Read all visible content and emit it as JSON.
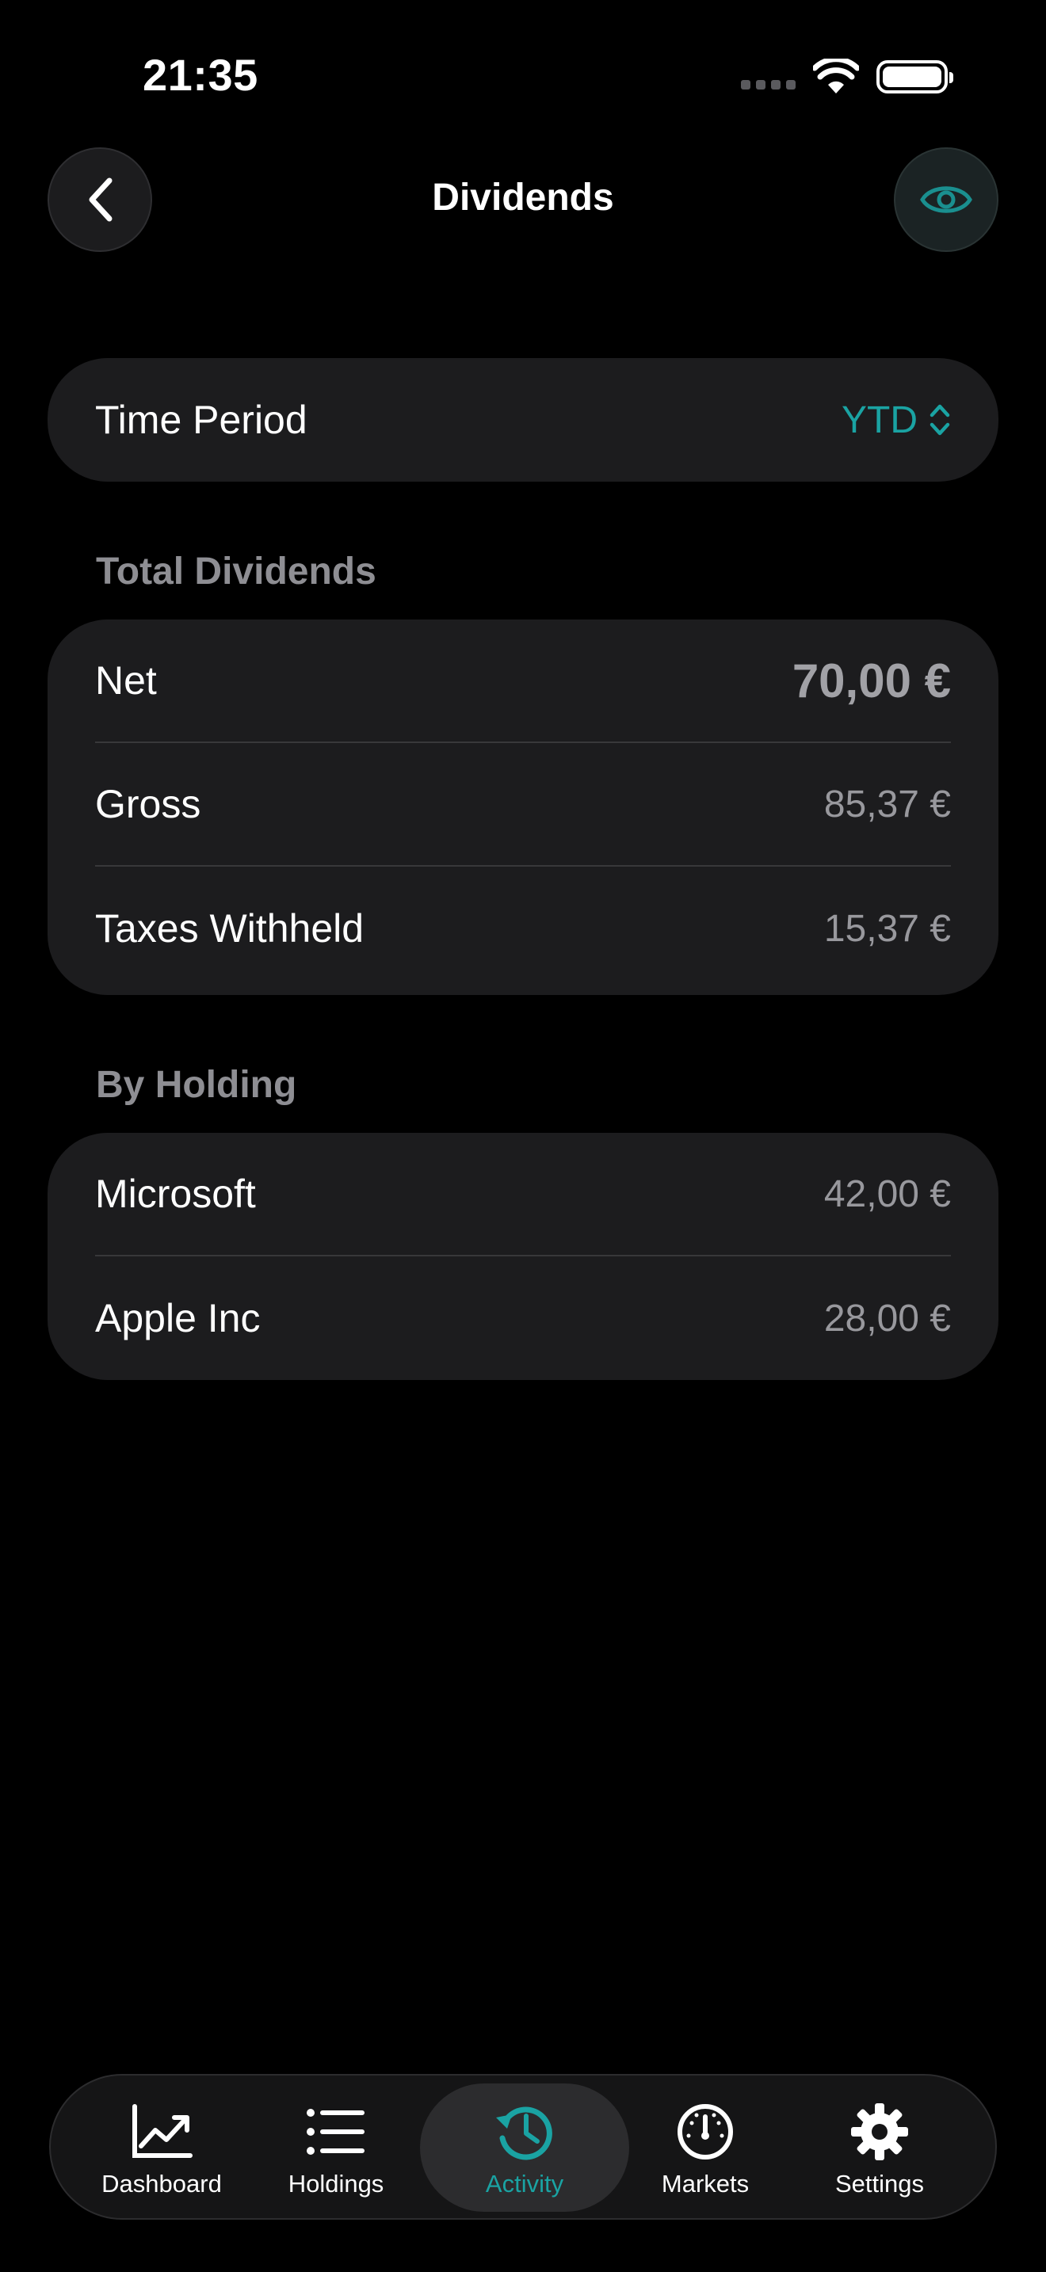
{
  "status": {
    "time": "21:35"
  },
  "nav": {
    "title": "Dividends",
    "back_icon": "chevron-left-icon",
    "visibility_icon": "eye-icon"
  },
  "time_period": {
    "label": "Time Period",
    "value": "YTD"
  },
  "total_dividends": {
    "section_title": "Total Dividends",
    "rows": [
      {
        "label": "Net",
        "value": "70,00 €"
      },
      {
        "label": "Gross",
        "value": "85,37 €"
      },
      {
        "label": "Taxes Withheld",
        "value": "15,37 €"
      }
    ]
  },
  "by_holding": {
    "section_title": "By Holding",
    "rows": [
      {
        "label": "Microsoft",
        "value": "42,00 €"
      },
      {
        "label": "Apple Inc",
        "value": "28,00 €"
      }
    ]
  },
  "tabs": [
    {
      "label": "Dashboard",
      "icon": "chart-line-icon"
    },
    {
      "label": "Holdings",
      "icon": "list-icon"
    },
    {
      "label": "Activity",
      "icon": "clock-history-icon",
      "active": true
    },
    {
      "label": "Markets",
      "icon": "gauge-icon"
    },
    {
      "label": "Settings",
      "icon": "gear-icon"
    }
  ],
  "colors": {
    "accent": "#1aa3a3",
    "background": "#000000",
    "card": "#1c1c1e"
  }
}
